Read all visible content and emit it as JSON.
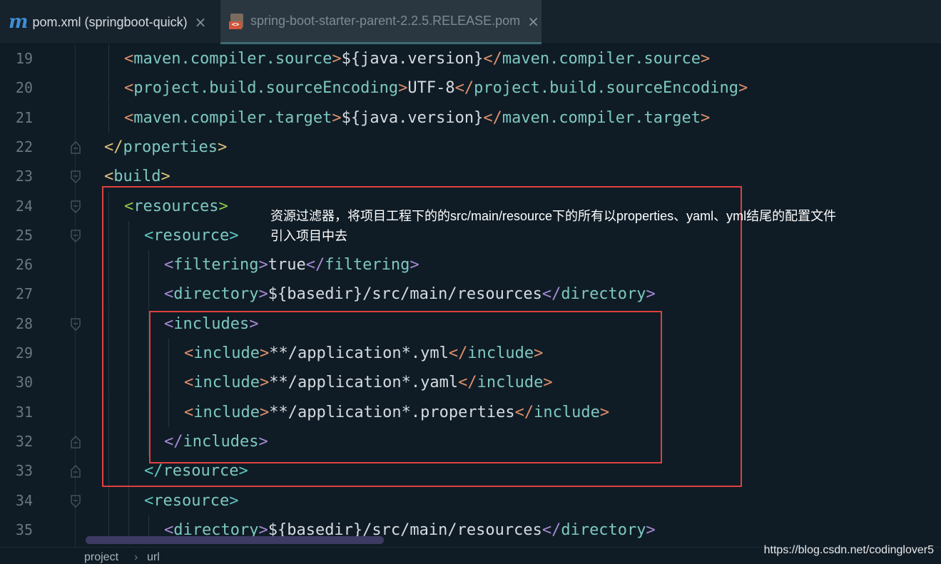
{
  "tabs": [
    {
      "icon": "maven-m-icon",
      "label": "pom.xml (springboot-quick)",
      "active": true
    },
    {
      "icon": "pom-file-icon",
      "label": "spring-boot-starter-parent-2.2.5.RELEASE.pom",
      "active": false
    }
  ],
  "editor": {
    "lines": [
      {
        "num": "19",
        "open_tag": "maven.compiler.source",
        "text": "${java.version}",
        "close_tag": "maven.compiler.source"
      },
      {
        "num": "20",
        "open_tag": "project.build.sourceEncoding",
        "text": "UTF-8",
        "close_tag": "project.build.sourceEncoding"
      },
      {
        "num": "21",
        "open_tag": "maven.compiler.target",
        "text": "${java.version}",
        "close_tag": "maven.compiler.target"
      },
      {
        "num": "22",
        "close_only": "properties"
      },
      {
        "num": "23",
        "open_only": "build"
      },
      {
        "num": "24",
        "open_only": "resources"
      },
      {
        "num": "25",
        "open_only": "resource"
      },
      {
        "num": "26",
        "open_tag": "filtering",
        "text": "true",
        "close_tag": "filtering"
      },
      {
        "num": "27",
        "open_tag": "directory",
        "text": "${basedir}/src/main/resources",
        "close_tag": "directory"
      },
      {
        "num": "28",
        "open_only": "includes"
      },
      {
        "num": "29",
        "open_tag": "include",
        "text": "**/application*.yml",
        "close_tag": "include"
      },
      {
        "num": "30",
        "open_tag": "include",
        "text": "**/application*.yaml",
        "close_tag": "include"
      },
      {
        "num": "31",
        "open_tag": "include",
        "text": "**/application*.properties",
        "close_tag": "include"
      },
      {
        "num": "32",
        "close_only": "includes"
      },
      {
        "num": "33",
        "close_only": "resource"
      },
      {
        "num": "34",
        "open_only": "resource"
      },
      {
        "num": "35",
        "open_tag": "directory",
        "text": "${basedir}/src/main/resources",
        "close_tag": "directory"
      }
    ]
  },
  "annotation": {
    "line1": "资源过滤器，将项目工程下的的src/main/resource下的所有以properties、yaml、yml结尾的配置文件",
    "line2": "引入项目中去"
  },
  "breadcrumb": {
    "item1": "project",
    "separator": "›",
    "item2": "url"
  },
  "watermark": "https://blog.csdn.net/codinglover5",
  "colors": {
    "background": "#0f1c26",
    "highlight_box": "#e04040",
    "tag": "#7ec8c0"
  }
}
